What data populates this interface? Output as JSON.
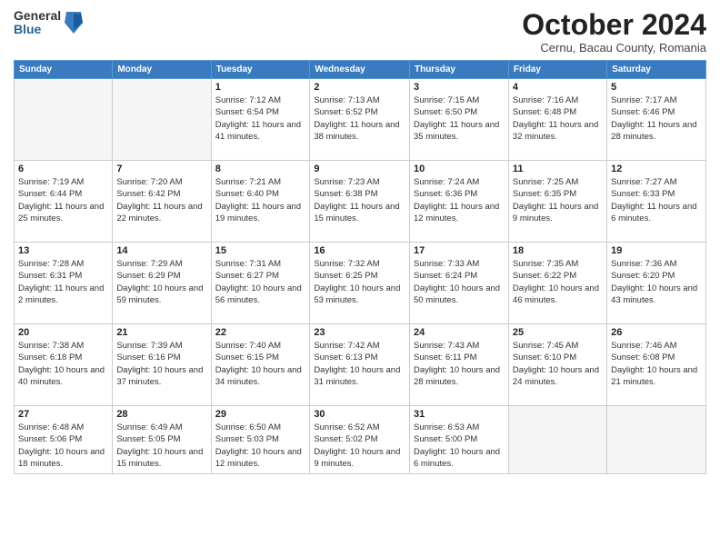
{
  "header": {
    "logo_general": "General",
    "logo_blue": "Blue",
    "month_title": "October 2024",
    "location": "Cernu, Bacau County, Romania"
  },
  "weekdays": [
    "Sunday",
    "Monday",
    "Tuesday",
    "Wednesday",
    "Thursday",
    "Friday",
    "Saturday"
  ],
  "weeks": [
    [
      {
        "day": "",
        "info": ""
      },
      {
        "day": "",
        "info": ""
      },
      {
        "day": "1",
        "info": "Sunrise: 7:12 AM\nSunset: 6:54 PM\nDaylight: 11 hours and 41 minutes."
      },
      {
        "day": "2",
        "info": "Sunrise: 7:13 AM\nSunset: 6:52 PM\nDaylight: 11 hours and 38 minutes."
      },
      {
        "day": "3",
        "info": "Sunrise: 7:15 AM\nSunset: 6:50 PM\nDaylight: 11 hours and 35 minutes."
      },
      {
        "day": "4",
        "info": "Sunrise: 7:16 AM\nSunset: 6:48 PM\nDaylight: 11 hours and 32 minutes."
      },
      {
        "day": "5",
        "info": "Sunrise: 7:17 AM\nSunset: 6:46 PM\nDaylight: 11 hours and 28 minutes."
      }
    ],
    [
      {
        "day": "6",
        "info": "Sunrise: 7:19 AM\nSunset: 6:44 PM\nDaylight: 11 hours and 25 minutes."
      },
      {
        "day": "7",
        "info": "Sunrise: 7:20 AM\nSunset: 6:42 PM\nDaylight: 11 hours and 22 minutes."
      },
      {
        "day": "8",
        "info": "Sunrise: 7:21 AM\nSunset: 6:40 PM\nDaylight: 11 hours and 19 minutes."
      },
      {
        "day": "9",
        "info": "Sunrise: 7:23 AM\nSunset: 6:38 PM\nDaylight: 11 hours and 15 minutes."
      },
      {
        "day": "10",
        "info": "Sunrise: 7:24 AM\nSunset: 6:36 PM\nDaylight: 11 hours and 12 minutes."
      },
      {
        "day": "11",
        "info": "Sunrise: 7:25 AM\nSunset: 6:35 PM\nDaylight: 11 hours and 9 minutes."
      },
      {
        "day": "12",
        "info": "Sunrise: 7:27 AM\nSunset: 6:33 PM\nDaylight: 11 hours and 6 minutes."
      }
    ],
    [
      {
        "day": "13",
        "info": "Sunrise: 7:28 AM\nSunset: 6:31 PM\nDaylight: 11 hours and 2 minutes."
      },
      {
        "day": "14",
        "info": "Sunrise: 7:29 AM\nSunset: 6:29 PM\nDaylight: 10 hours and 59 minutes."
      },
      {
        "day": "15",
        "info": "Sunrise: 7:31 AM\nSunset: 6:27 PM\nDaylight: 10 hours and 56 minutes."
      },
      {
        "day": "16",
        "info": "Sunrise: 7:32 AM\nSunset: 6:25 PM\nDaylight: 10 hours and 53 minutes."
      },
      {
        "day": "17",
        "info": "Sunrise: 7:33 AM\nSunset: 6:24 PM\nDaylight: 10 hours and 50 minutes."
      },
      {
        "day": "18",
        "info": "Sunrise: 7:35 AM\nSunset: 6:22 PM\nDaylight: 10 hours and 46 minutes."
      },
      {
        "day": "19",
        "info": "Sunrise: 7:36 AM\nSunset: 6:20 PM\nDaylight: 10 hours and 43 minutes."
      }
    ],
    [
      {
        "day": "20",
        "info": "Sunrise: 7:38 AM\nSunset: 6:18 PM\nDaylight: 10 hours and 40 minutes."
      },
      {
        "day": "21",
        "info": "Sunrise: 7:39 AM\nSunset: 6:16 PM\nDaylight: 10 hours and 37 minutes."
      },
      {
        "day": "22",
        "info": "Sunrise: 7:40 AM\nSunset: 6:15 PM\nDaylight: 10 hours and 34 minutes."
      },
      {
        "day": "23",
        "info": "Sunrise: 7:42 AM\nSunset: 6:13 PM\nDaylight: 10 hours and 31 minutes."
      },
      {
        "day": "24",
        "info": "Sunrise: 7:43 AM\nSunset: 6:11 PM\nDaylight: 10 hours and 28 minutes."
      },
      {
        "day": "25",
        "info": "Sunrise: 7:45 AM\nSunset: 6:10 PM\nDaylight: 10 hours and 24 minutes."
      },
      {
        "day": "26",
        "info": "Sunrise: 7:46 AM\nSunset: 6:08 PM\nDaylight: 10 hours and 21 minutes."
      }
    ],
    [
      {
        "day": "27",
        "info": "Sunrise: 6:48 AM\nSunset: 5:06 PM\nDaylight: 10 hours and 18 minutes."
      },
      {
        "day": "28",
        "info": "Sunrise: 6:49 AM\nSunset: 5:05 PM\nDaylight: 10 hours and 15 minutes."
      },
      {
        "day": "29",
        "info": "Sunrise: 6:50 AM\nSunset: 5:03 PM\nDaylight: 10 hours and 12 minutes."
      },
      {
        "day": "30",
        "info": "Sunrise: 6:52 AM\nSunset: 5:02 PM\nDaylight: 10 hours and 9 minutes."
      },
      {
        "day": "31",
        "info": "Sunrise: 6:53 AM\nSunset: 5:00 PM\nDaylight: 10 hours and 6 minutes."
      },
      {
        "day": "",
        "info": ""
      },
      {
        "day": "",
        "info": ""
      }
    ]
  ]
}
